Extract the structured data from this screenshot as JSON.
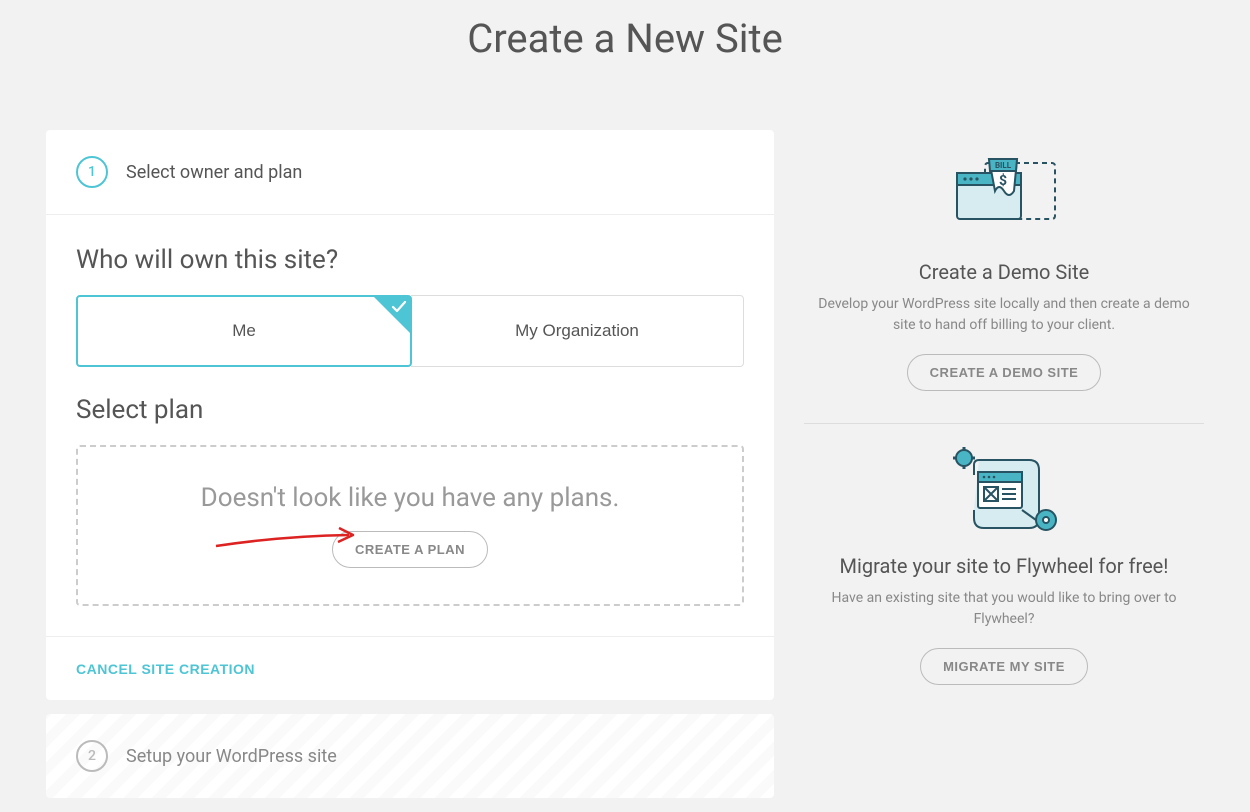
{
  "header": {
    "title": "Create a New Site"
  },
  "steps": {
    "step1": {
      "num": "1",
      "label": "Select owner and plan"
    },
    "step2": {
      "num": "2",
      "label": "Setup your WordPress site"
    }
  },
  "owner": {
    "question": "Who will own this site?",
    "me": "Me",
    "org": "My Organization"
  },
  "plan": {
    "title": "Select plan",
    "empty": "Doesn't look like you have any plans.",
    "create_btn": "CREATE A PLAN"
  },
  "footer": {
    "cancel": "CANCEL SITE CREATION"
  },
  "sidebar": {
    "demo": {
      "title": "Create a Demo Site",
      "desc": "Develop your WordPress site locally and then create a demo site to hand off billing to your client.",
      "btn": "CREATE A DEMO SITE"
    },
    "migrate": {
      "title": "Migrate your site to Flywheel for free!",
      "desc": "Have an existing site that you would like to bring over to Flywheel?",
      "btn": "MIGRATE MY SITE"
    }
  }
}
